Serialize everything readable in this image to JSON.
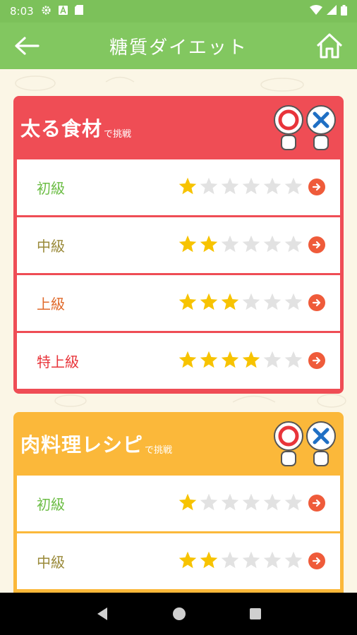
{
  "status": {
    "time": "8:03",
    "icons": [
      "gear-icon",
      "a-badge-icon",
      "sd-card-icon",
      "wifi-icon",
      "signal-icon",
      "battery-icon"
    ]
  },
  "header": {
    "title": "糖質ダイエット",
    "back_icon": "arrow-left-icon",
    "home_icon": "home-icon"
  },
  "cards": [
    {
      "title": "太る食材",
      "subtitle": "で挑戦",
      "color": "#ef4d55",
      "levels": [
        {
          "label": "初級",
          "stars": 1,
          "label_color": "#6cbd45"
        },
        {
          "label": "中級",
          "stars": 2,
          "label_color": "#9a8a3a"
        },
        {
          "label": "上級",
          "stars": 3,
          "label_color": "#e06a2b"
        },
        {
          "label": "特上級",
          "stars": 4,
          "label_color": "#e8343a"
        }
      ]
    },
    {
      "title": "肉料理レシピ",
      "subtitle": "で挑戦",
      "color": "#fbb83a",
      "levels": [
        {
          "label": "初級",
          "stars": 1,
          "label_color": "#6cbd45"
        },
        {
          "label": "中級",
          "stars": 2,
          "label_color": "#9a8a3a"
        }
      ]
    }
  ],
  "max_stars": 6,
  "colors": {
    "app_bar": "#82c760",
    "background": "#fbf6e6",
    "star_on": "#f7c300",
    "star_off": "#e2e2e2",
    "arrow": "#ef5b3a"
  }
}
